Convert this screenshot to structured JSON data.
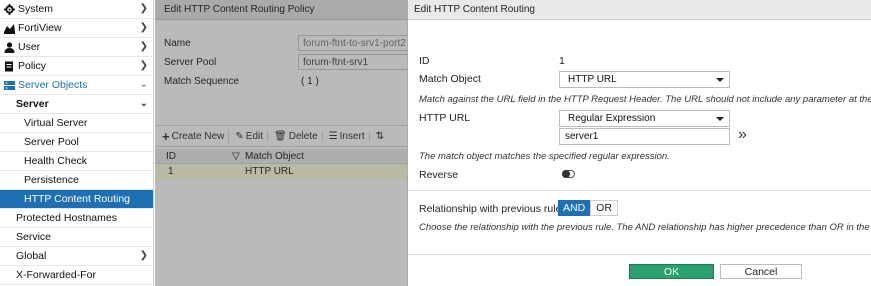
{
  "sidebar": {
    "items": [
      {
        "label": "System",
        "icon": "gear-icon"
      },
      {
        "label": "FortiView",
        "icon": "chart-icon"
      },
      {
        "label": "User",
        "icon": "user-icon"
      },
      {
        "label": "Policy",
        "icon": "document-icon"
      },
      {
        "label": "Server Objects",
        "icon": "server-icon"
      },
      {
        "label": "Server"
      },
      {
        "label": "Virtual Server"
      },
      {
        "label": "Server Pool"
      },
      {
        "label": "Health Check"
      },
      {
        "label": "Persistence"
      },
      {
        "label": "HTTP Content Routing"
      },
      {
        "label": "Protected Hostnames"
      },
      {
        "label": "Service"
      },
      {
        "label": "Global"
      },
      {
        "label": "X-Forwarded-For"
      }
    ],
    "accent": "#1f6fb5"
  },
  "bg_panel": {
    "title": "Edit HTTP Content Routing Policy",
    "name_label": "Name",
    "name_value": "forum-ftnt-to-srv1-port2",
    "pool_label": "Server Pool",
    "pool_value": "forum-ftnt-srv1",
    "seq_label": "Match Sequence",
    "seq_value": "( 1 )",
    "toolbar": {
      "create": "Create New",
      "edit": "Edit",
      "delete": "Delete",
      "insert": "Insert"
    },
    "grid": {
      "col_id": "ID",
      "col_match": "Match Object",
      "row_id": "1",
      "row_match": "HTTP URL"
    }
  },
  "dialog": {
    "title": "Edit HTTP Content Routing",
    "id_label": "ID",
    "id_value": "1",
    "match_object_label": "Match Object",
    "match_object_value": "HTTP URL",
    "match_object_hint": "Match against the URL field in the HTTP Request Header. The URL should not include any parameter at the end.",
    "http_url_label": "HTTP URL",
    "http_url_type": "Regular Expression",
    "http_url_value": "server1",
    "regex_hint": "The match object matches the specified regular expression.",
    "reverse_label": "Reverse",
    "relationship_label": "Relationship with previous rule",
    "and_label": "AND",
    "or_label": "OR",
    "relationship_hint": "Choose the relationship with the previous rule. The AND relationship has higher precedence than OR in the mat",
    "ok_label": "OK",
    "cancel_label": "Cancel",
    "ok_color": "#2aa06d"
  }
}
